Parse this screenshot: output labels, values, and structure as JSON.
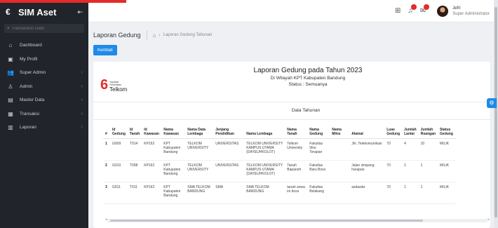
{
  "app": {
    "title": "SIM Aset"
  },
  "sidebar": {
    "search_placeholder": "Transaction code",
    "items": [
      {
        "label": "Dashboard",
        "icon": "home-icon",
        "has_children": false
      },
      {
        "label": "My Profil",
        "icon": "id-card-icon",
        "has_children": false
      },
      {
        "label": "Super Admin",
        "icon": "users-icon",
        "has_children": true
      },
      {
        "label": "Admin",
        "icon": "user-icon",
        "has_children": true
      },
      {
        "label": "Master Data",
        "icon": "database-icon",
        "has_children": true
      },
      {
        "label": "Transaksi",
        "icon": "transaction-icon",
        "has_children": true
      },
      {
        "label": "Laporan",
        "icon": "report-icon",
        "has_children": true
      }
    ]
  },
  "topbar": {
    "badges": [
      "",
      ""
    ],
    "user": {
      "name": "Jefri",
      "role": "Super Administrator"
    }
  },
  "breadcrumb": {
    "title": "Laporan Gedung",
    "current": "Laporan Gedung Tahunan"
  },
  "buttons": {
    "back": "Kembali"
  },
  "report": {
    "logo_small_1": "Yayasan",
    "logo_small_2": "Pendidikan",
    "logo_text": "Telkom",
    "title": "Laporan Gedung pada Tahun 2023",
    "subtitle": "Di Wilayah KPT Kabupaten Bandung",
    "status": "Status : Semuanya",
    "section": "Data Tahunan"
  },
  "table": {
    "headers": [
      "#",
      "Id Gedung",
      "Id Tanah",
      "Id Kawasan",
      "Nama Kawasan",
      "Nama Data Lembaga",
      "Jenjang Pendidikan",
      "Nama Lembaga",
      "Nama Tanah",
      "Nama Gedung",
      "Nama Mitra",
      "Alamat",
      "Luas Gedung",
      "Jumlah Lantai",
      "Jumlah Ruangan",
      "Status Gedung"
    ],
    "rows": [
      [
        "1",
        "G009",
        "T014",
        "KP162",
        "KPT Kabupaten Bandung",
        "TELKOM UNIVERSITY",
        "UNIVERSITAS",
        "TELKOM UNIVERSITY KAMPUS UTAMA (DAYEUHKOLOT)",
        "Telkom University",
        "Fakultas Ilmu Terapan",
        "",
        "Jln. Telekomunikasi",
        "70",
        "4",
        "10",
        "MILIK"
      ],
      [
        "2",
        "G010",
        "T008",
        "KP162",
        "KPT Kabupaten Bandung",
        "TELKOM UNIVERSITY",
        "UNIVERSITAS",
        "TELKOM UNIVERSITY KAMPUS UTAMA (DAYEUHKOLOT)",
        "Tanah Bapaneh",
        "Fakultas Baru Boss",
        "",
        "Jalan simpang harapan",
        "70",
        "1",
        "1",
        "MILIK"
      ],
      [
        "3",
        "G011",
        "T011",
        "KP162",
        "KPT Kabupaten Bandung",
        "SMA TELKOM BANDUNG",
        "SMA",
        "SMA TELKOM BANDUNG",
        "tanah sewa ini boss",
        "Fakultas Belakang",
        "",
        "asdasda",
        "70",
        "1",
        "1",
        "MILIK"
      ]
    ]
  },
  "colors": {
    "accent": "#1f8ae8",
    "brand_red": "#e32b2b",
    "sidebar_bg": "#21252b"
  }
}
